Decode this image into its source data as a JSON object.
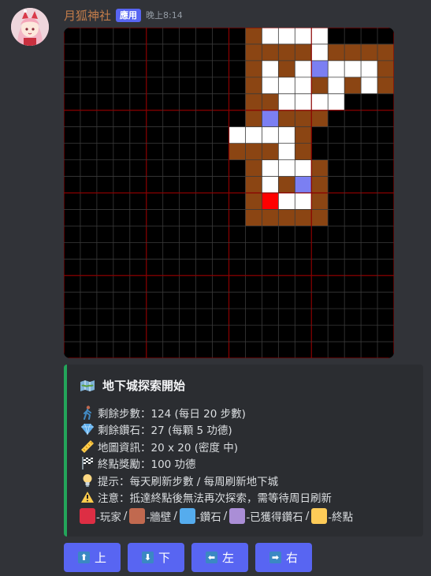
{
  "message": {
    "username": "月狐神社",
    "badge": "應用",
    "timestamp": "晚上8:14"
  },
  "map": {
    "colors": {
      "background": "#000000",
      "grid": "#3a3a3a",
      "major_grid": "#8b0000",
      "wall": "#8b4513",
      "path": "#ffffff",
      "diamond": "#7b7ff2",
      "player": "#ff0000"
    },
    "rows": [
      "....................",
      "...........W...WWWWW",
      "...........WWWWWWWWW",
      "...........WW.WWWW.W",
      "...........WWWW.WW.W",
      "...........WWW.WWWWW",
      "...........WWWWWWWWW",
      ".........WWWWWWWWWWW",
      ".........WWWWWWWWWWW",
      ".........WWWWWWWWW.W",
      "...........WWWWWWWWW",
      "..........WWWWWWWWWW",
      "...........W........",
      "....................",
      "....................",
      "....................",
      "....................",
      "....................",
      "....................",
      "...................."
    ],
    "cells": [
      "WW",
      "WP",
      "WP",
      "WP",
      "WP",
      "WW",
      "WW",
      "WW",
      "WP",
      "WW",
      "WW",
      "WW",
      "WW",
      "WW",
      "WW",
      "WP",
      "WW",
      "WP",
      "WD",
      "WP",
      "WP",
      "WP",
      "WW",
      "WP",
      "WP",
      "WP",
      "WW",
      "WP",
      "WW",
      "WP",
      "WW",
      "WW",
      "WP",
      "WP",
      "WP",
      "WP",
      "WW",
      "WD",
      "WW",
      "WW",
      "WW",
      "WP",
      "WP",
      "WP",
      "WP",
      "WW",
      "WW",
      "WW",
      "WW",
      "WP",
      "WW",
      "WW",
      "WP",
      "WP",
      "WP",
      "WW",
      "WP",
      "WW",
      "WD",
      "WW",
      "WW",
      "WR",
      "WP",
      "WP",
      "WW",
      "WW",
      "WW",
      "WW",
      "WW",
      "WW"
    ]
  },
  "embed": {
    "title": "地下城探索開始",
    "title_icon": "map-icon",
    "lines": [
      {
        "icon": "walking-person-icon",
        "text": "剩餘步數：124 (每日 20 步數)"
      },
      {
        "icon": "gem-icon",
        "text": "剩餘鑽石：27 (每顆 5 功德)"
      },
      {
        "icon": "ruler-icon",
        "text": "地圖資訊：20 x 20 (密度 中)"
      },
      {
        "icon": "checkered-flag-icon",
        "text": "終點獎勵：100 功德"
      },
      {
        "icon": "lightbulb-icon",
        "text": "提示：每天刷新步數 / 每周刷新地下城"
      },
      {
        "icon": "warning-icon",
        "text": "注意：抵達終點後無法再次探索，需等待周日刷新"
      }
    ],
    "legend": [
      {
        "color": "#dd2e44",
        "label": "-玩家"
      },
      {
        "color": "#c1694f",
        "label": "-牆壁"
      },
      {
        "color": "#55acee",
        "label": "-鑽石"
      },
      {
        "color": "#aa8ed6",
        "label": "-已獲得鑽石"
      },
      {
        "color": "#fdcb58",
        "label": "-終點"
      }
    ],
    "accent": "#23a55a"
  },
  "buttons": [
    {
      "label": "上",
      "icon": "arrow-up-icon",
      "glyph": "⬆"
    },
    {
      "label": "下",
      "icon": "arrow-down-icon",
      "glyph": "⬇"
    },
    {
      "label": "左",
      "icon": "arrow-left-icon",
      "glyph": "⬅"
    },
    {
      "label": "右",
      "icon": "arrow-right-icon",
      "glyph": "➡"
    }
  ]
}
